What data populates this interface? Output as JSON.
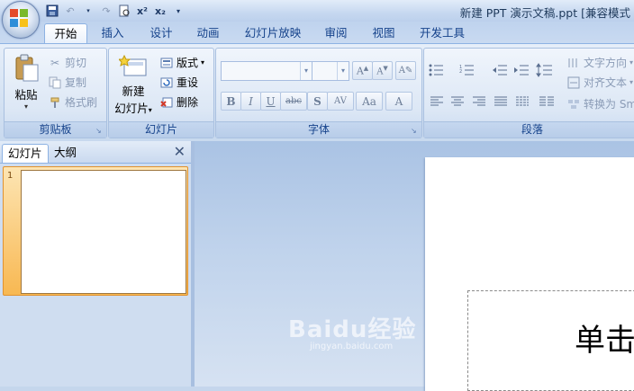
{
  "title_bar": {
    "title": "新建 PPT 演示文稿.ppt [兼容模式"
  },
  "ribbon_tabs": [
    "开始",
    "插入",
    "设计",
    "动画",
    "幻灯片放映",
    "审阅",
    "视图",
    "开发工具"
  ],
  "clipboard": {
    "paste": "粘贴",
    "cut": "剪切",
    "copy": "复制",
    "format_painter": "格式刷",
    "group_label": "剪贴板"
  },
  "slides_group": {
    "new_slide_line1": "新建",
    "new_slide_line2": "幻灯片",
    "layout": "版式",
    "reset": "重设",
    "delete": "删除",
    "group_label": "幻灯片"
  },
  "font_group": {
    "group_label": "字体",
    "font_name_value": "",
    "font_size_value": "",
    "buttons": [
      "B",
      "I",
      "U",
      "abc",
      "S",
      "AV",
      "Aa",
      "A"
    ]
  },
  "paragraph_group": {
    "text_direction": "文字方向",
    "align_text": "对齐文本",
    "convert_smartart": "转换为 Sm",
    "group_label": "段落"
  },
  "slide_pane": {
    "tab_slides": "幻灯片",
    "tab_outline": "大纲",
    "thumbnail_number": "1"
  },
  "slide": {
    "placeholder_text": "单击"
  },
  "watermark": {
    "main": "Baidu经验",
    "sub": "jingyan.baidu.com"
  },
  "colors": {
    "accent": "#15428b",
    "selection": "#f8b852"
  }
}
